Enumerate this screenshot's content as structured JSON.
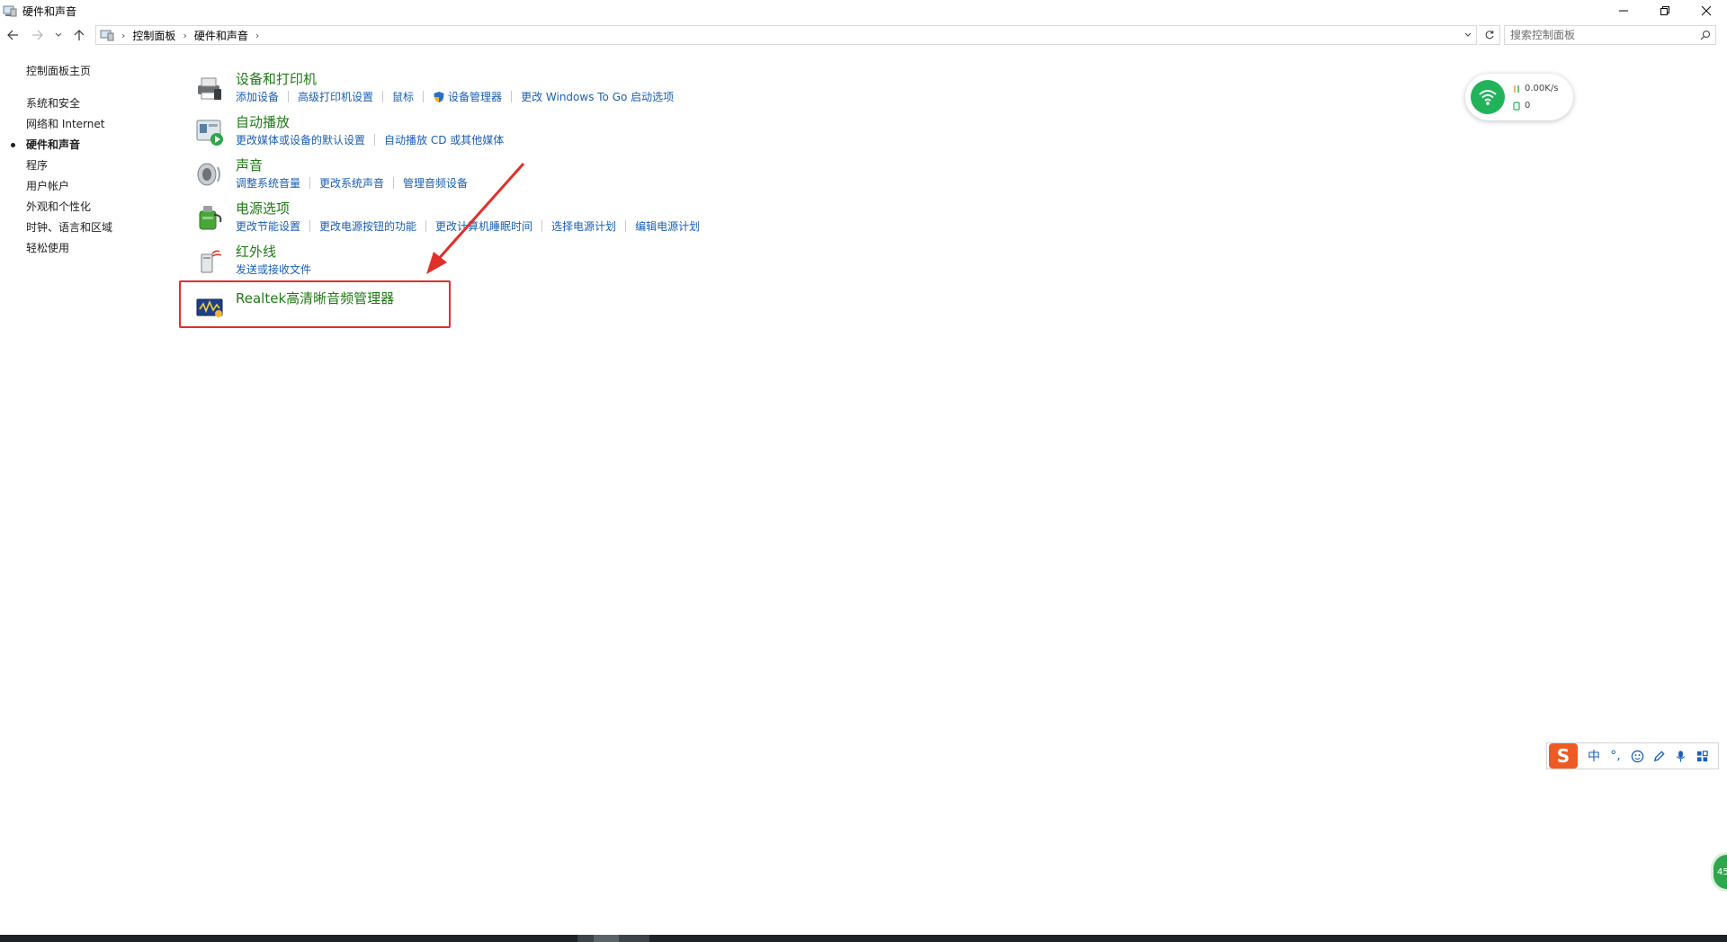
{
  "window": {
    "title": "硬件和声音",
    "icon": "control-panel-icon"
  },
  "address_bar": {
    "crumbs": [
      "控制面板",
      "硬件和声音"
    ],
    "search_placeholder": "搜索控制面板"
  },
  "left_nav": {
    "home": "控制面板主页",
    "items": [
      {
        "label": "系统和安全",
        "active": false
      },
      {
        "label": "网络和 Internet",
        "active": false
      },
      {
        "label": "硬件和声音",
        "active": true
      },
      {
        "label": "程序",
        "active": false
      },
      {
        "label": "用户帐户",
        "active": false
      },
      {
        "label": "外观和个性化",
        "active": false
      },
      {
        "label": "时钟、语言和区域",
        "active": false
      },
      {
        "label": "轻松使用",
        "active": false
      }
    ]
  },
  "categories": [
    {
      "title": "设备和打印机",
      "icon": "printer-icon",
      "links": [
        "添加设备",
        "高级打印机设置",
        "鼠标",
        "设备管理器",
        "更改 Windows To Go 启动选项"
      ]
    },
    {
      "title": "自动播放",
      "icon": "autoplay-icon",
      "links": [
        "更改媒体或设备的默认设置",
        "自动播放 CD 或其他媒体"
      ]
    },
    {
      "title": "声音",
      "icon": "speaker-icon",
      "links": [
        "调整系统音量",
        "更改系统声音",
        "管理音频设备"
      ]
    },
    {
      "title": "电源选项",
      "icon": "power-options-icon",
      "links": [
        "更改节能设置",
        "更改电源按钮的功能",
        "更改计算机睡眠时间",
        "选择电源计划",
        "编辑电源计划"
      ]
    },
    {
      "title": "红外线",
      "icon": "infrared-icon",
      "links": [
        "发送或接收文件"
      ]
    },
    {
      "title": "Realtek高清晰音频管理器",
      "icon": "realtek-audio-icon",
      "links": []
    }
  ],
  "net_widget": {
    "speed": "0.00K/s",
    "count": "0"
  },
  "ime_toolbar": {
    "logo": "S",
    "mode": "中",
    "punct": "°,"
  },
  "float_ball": {
    "value": "45"
  },
  "colors": {
    "category_title": "#1e7a14",
    "link": "#1a5fb4",
    "highlight": "#e0302a",
    "wifi": "#21b35a"
  }
}
